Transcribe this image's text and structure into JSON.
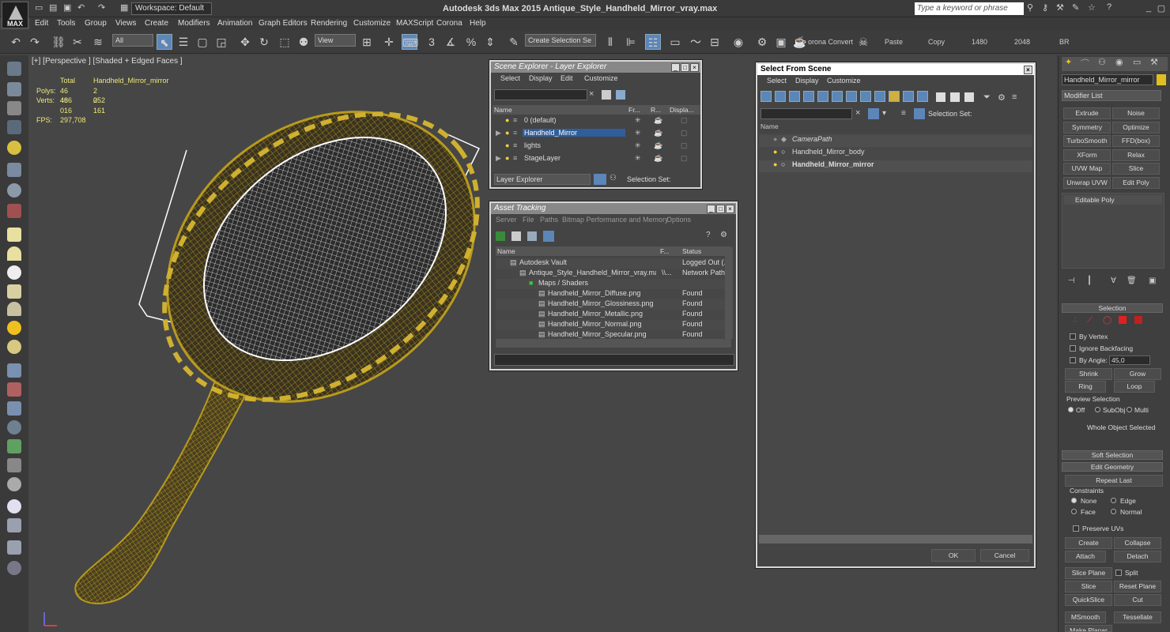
{
  "titlebar": {
    "logo": "MAX",
    "workspace": "Workspace: Default",
    "app_title": "Autodesk 3ds Max  2015     Antique_Style_Handheld_Mirror_vray.max",
    "search_placeholder": "Type a keyword or phrase"
  },
  "menu": [
    "Edit",
    "Tools",
    "Group",
    "Views",
    "Create",
    "Modifiers",
    "Animation",
    "Graph Editors",
    "Rendering",
    "Customize",
    "MAXScript",
    "Corona",
    "Help"
  ],
  "toolbar": {
    "filter": "All",
    "ref_coord": "View",
    "snap_value": "3",
    "create_selection_set": "Create Selection Se",
    "corona_convert": "orona Convert",
    "paste": "Paste",
    "copy": "Copy",
    "width": "1480",
    "height": "2048",
    "br": "BR"
  },
  "viewport": {
    "label": "[+] [Perspective ] [Shaded + Edged Faces ]",
    "stats": {
      "col_total": "Total",
      "col_object": "Handheld_Mirror_mirror",
      "polys_label": "Polys:",
      "polys_total": "46 486",
      "polys_obj": "2 052",
      "verts_label": "Verts:",
      "verts_total": "46 016",
      "verts_obj": "2 161",
      "fps_label": "FPS:",
      "fps": "297,708"
    }
  },
  "scene_explorer": {
    "title": "Scene Explorer - Layer Explorer",
    "menu": [
      "Select",
      "Display",
      "Edit",
      "Customize"
    ],
    "columns": [
      "Name",
      "Fr...",
      "R...",
      "Displa..."
    ],
    "rows": [
      {
        "name": "0 (default)",
        "selected": false
      },
      {
        "name": "Handheld_Mirror",
        "selected": true
      },
      {
        "name": "lights",
        "selected": false
      },
      {
        "name": "StageLayer",
        "selected": false
      }
    ],
    "footer_dropdown": "Layer Explorer",
    "selection_set_label": "Selection Set:"
  },
  "asset_tracking": {
    "title": "Asset Tracking",
    "menu": [
      "Server",
      "File",
      "Paths",
      "Bitmap Performance and Memory",
      "Options"
    ],
    "columns": [
      "Name",
      "F...",
      "Status"
    ],
    "rows": [
      {
        "name": "Autodesk Vault",
        "f": "",
        "status": "Logged Out (...",
        "indent": 1
      },
      {
        "name": "Antique_Style_Handheld_Mirror_vray.max",
        "f": "\\\\...",
        "status": "Network Path",
        "indent": 2
      },
      {
        "name": "Maps / Shaders",
        "f": "",
        "status": "",
        "indent": 3
      },
      {
        "name": "Handheld_Mirror_Diffuse.png",
        "f": "",
        "status": "Found",
        "indent": 4
      },
      {
        "name": "Handheld_Mirror_Glossiness.png",
        "f": "",
        "status": "Found",
        "indent": 4
      },
      {
        "name": "Handheld_Mirror_Metallic.png",
        "f": "",
        "status": "Found",
        "indent": 4
      },
      {
        "name": "Handheld_Mirror_Normal.png",
        "f": "",
        "status": "Found",
        "indent": 4
      },
      {
        "name": "Handheld_Mirror_Specular.png",
        "f": "",
        "status": "Found",
        "indent": 4
      }
    ]
  },
  "select_from_scene": {
    "title": "Select From Scene",
    "menu": [
      "Select",
      "Display",
      "Customize"
    ],
    "selection_set_label": "Selection Set:",
    "column": "Name",
    "rows": [
      {
        "name": "CameraPath",
        "style": "italic"
      },
      {
        "name": "Handheld_Mirror_body",
        "style": "normal"
      },
      {
        "name": "Handheld_Mirror_mirror",
        "style": "bold"
      }
    ],
    "ok": "OK",
    "cancel": "Cancel"
  },
  "command_panel": {
    "object_name": "Handheld_Mirror_mirror",
    "modifier_list": "Modifier List",
    "buttons": [
      "Extrude",
      "Noise",
      "Symmetry",
      "Optimize",
      "TurboSmooth",
      "FFD(box)",
      "XForm",
      "Relax",
      "UVW Map",
      "Slice",
      "Unwrap UVW",
      "Edit Poly"
    ],
    "stack_item": "Editable Poly",
    "selection_rollout": "Selection",
    "by_vertex": "By Vertex",
    "ignore_backfacing": "Ignore Backfacing",
    "by_angle": "By Angle:",
    "angle_value": "45,0",
    "shrink": "Shrink",
    "grow": "Grow",
    "ring": "Ring",
    "loop": "Loop",
    "preview_selection": "Preview Selection",
    "preview_off": "Off",
    "preview_subobj": "SubObj",
    "preview_multi": "Multi",
    "whole_object": "Whole Object Selected",
    "soft_selection": "Soft Selection",
    "edit_geometry": "Edit Geometry",
    "repeat_last": "Repeat Last",
    "constraints": "Constraints",
    "c_none": "None",
    "c_edge": "Edge",
    "c_face": "Face",
    "c_normal": "Normal",
    "preserve_uvs": "Preserve UVs",
    "create": "Create",
    "collapse": "Collapse",
    "attach": "Attach",
    "detach": "Detach",
    "slice_plane": "Slice Plane",
    "split": "Split",
    "slice": "Slice",
    "reset_plane": "Reset Plane",
    "quickslice": "QuickSlice",
    "cut": "Cut",
    "msmooth": "MSmooth",
    "tessellate": "Tessellate",
    "make_planar": "Make Planar"
  },
  "colors": {
    "wire": "#b89a1e",
    "mirror_wire": "#ffffff",
    "selection_blue": "#315e9a"
  }
}
